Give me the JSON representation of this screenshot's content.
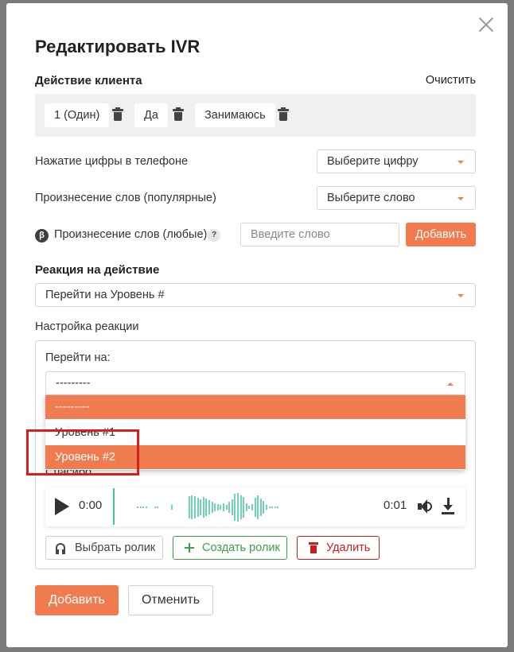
{
  "modal": {
    "title": "Редактировать IVR",
    "client_action_heading": "Действие клиента",
    "clear_label": "Очистить",
    "chips": [
      "1 (Один)",
      "Да",
      "Занимаюсь"
    ]
  },
  "digit_row": {
    "label": "Нажатие цифры в телефоне",
    "selected": "Выберите цифру"
  },
  "popular_row": {
    "label": "Произнесение слов (популярные)",
    "selected": "Выберите слово"
  },
  "any_words_row": {
    "beta": "β",
    "label": "Произнесение слов (любые)",
    "help": "?",
    "placeholder": "Введите слово",
    "add_label": "Добавить"
  },
  "reaction": {
    "heading": "Реакция на действие",
    "selected": "Перейти на Уровень #"
  },
  "reaction_settings": {
    "heading": "Настройка реакции",
    "goto_label": "Перейти на:",
    "goto_selected": "---------",
    "options": [
      "---------",
      "Уровень #1",
      "Уровень #2"
    ],
    "highlighted_index": 2,
    "hidden_label": "Спасибо"
  },
  "player": {
    "current_time": "0:00",
    "duration": "0:01"
  },
  "media_buttons": {
    "choose": "Выбрать ролик",
    "create": "Создать ролик",
    "delete": "Удалить"
  },
  "footer": {
    "submit": "Добавить",
    "cancel": "Отменить"
  },
  "colors": {
    "accent": "#f07b4f",
    "success": "#3aa04a",
    "danger": "#c91c1c",
    "wave": "#6dd4b6",
    "highlight_box": "#d91e1e"
  }
}
